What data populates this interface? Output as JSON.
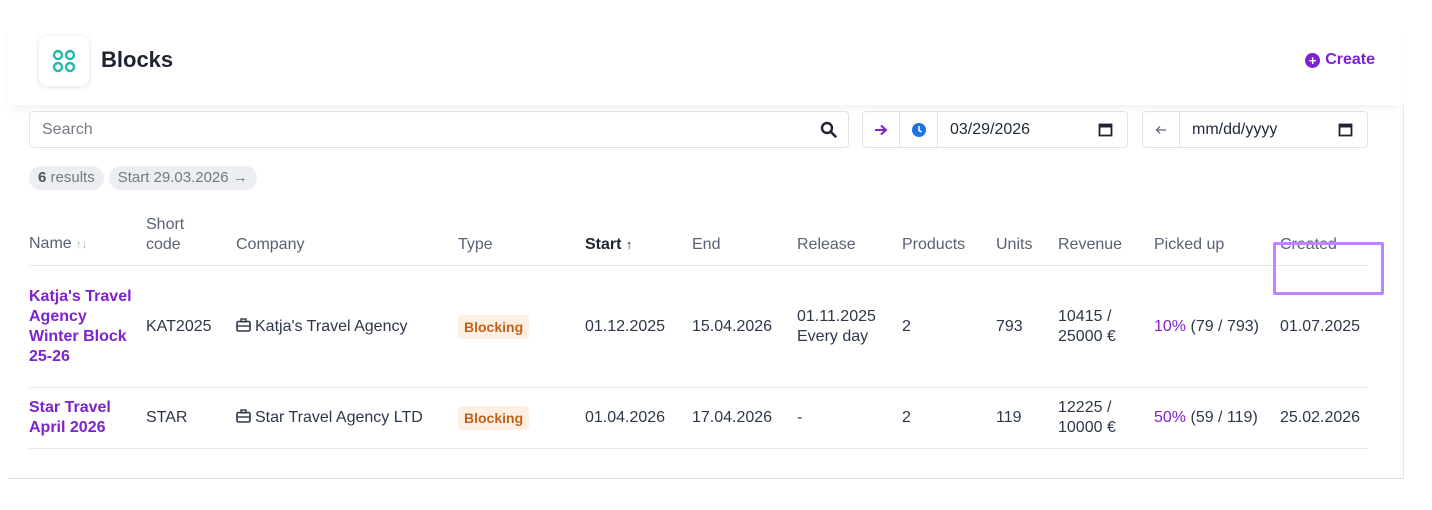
{
  "header": {
    "title": "Blocks",
    "create_label": "Create",
    "logo_icon": "grid-icon"
  },
  "filters": {
    "search_placeholder": "Search",
    "start_date": "03/29/2026",
    "end_date": "mm/dd/yyyy"
  },
  "summary": {
    "count": "6",
    "results_label": "results",
    "active_filter": "Start 29.03.2026 →"
  },
  "table": {
    "columns": {
      "name": "Name",
      "short_code": "Short code",
      "company": "Company",
      "type": "Type",
      "start": "Start",
      "end": "End",
      "release": "Release",
      "products": "Products",
      "units": "Units",
      "revenue": "Revenue",
      "picked_up": "Picked up",
      "created": "Created"
    },
    "rows": [
      {
        "name": "Katja's Travel Agency Winter Block 25-26",
        "short_code": "KAT2025",
        "company": "Katja's Travel Agency",
        "type": "Blocking",
        "start": "01.12.2025",
        "end": "15.04.2026",
        "release_date": "01.11.2025",
        "release_freq": "Every day",
        "products": "2",
        "units": "793",
        "revenue_a": "10415 /",
        "revenue_b": "25000 €",
        "picked_pct": "10%",
        "picked_detail": "(79 / 793)",
        "created": "01.07.2025"
      },
      {
        "name": "Star Travel April 2026",
        "short_code": "STAR",
        "company": "Star Travel Agency LTD",
        "type": "Blocking",
        "start": "01.04.2026",
        "end": "17.04.2026",
        "release_date": "-",
        "release_freq": "",
        "products": "2",
        "units": "119",
        "revenue_a": "12225 /",
        "revenue_b": "10000 €",
        "picked_pct": "50%",
        "picked_detail": "(59 / 119)",
        "created": "25.02.2026"
      }
    ]
  },
  "colors": {
    "accent": "#7e22ce",
    "badge_bg": "#fdf0e2",
    "badge_text": "#c2621a",
    "highlight": "#c084fc"
  }
}
